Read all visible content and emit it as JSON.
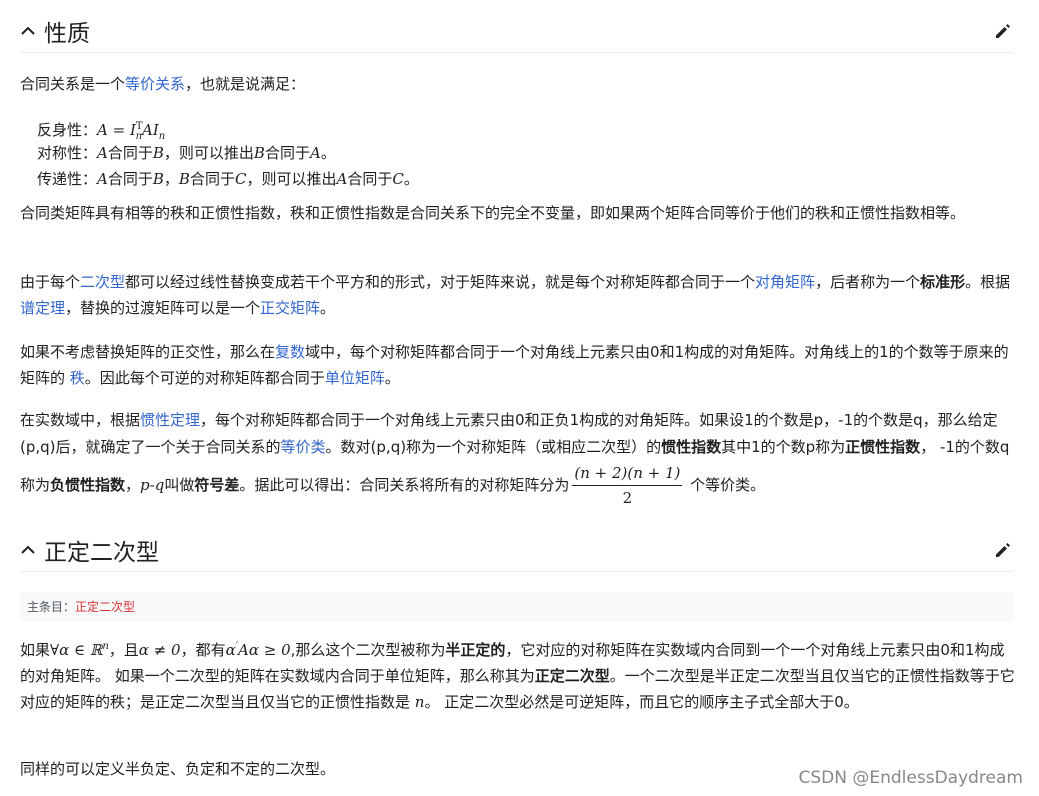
{
  "sections": {
    "properties": {
      "title": "性质"
    },
    "positive_definite": {
      "title": "正定二次型"
    }
  },
  "intro": {
    "t1": "合同关系是一个",
    "link": "等价关系",
    "t2": "，也就是说满足："
  },
  "defs": {
    "reflexive": {
      "label": "反身性：",
      "formula_a": "A",
      "eq": " = ",
      "formula_b": "I",
      "sup": "T",
      "sub": "n",
      "formula_c": "AI",
      "sub2": "n"
    },
    "symmetric": {
      "label": "对称性：",
      "a": "A",
      "t1": "合同于",
      "b": "B",
      "t2": "，则可以推出",
      "b2": "B",
      "t3": "合同于",
      "a2": "A",
      "t4": "。"
    },
    "transitive": {
      "label": "传递性：",
      "a": "A",
      "t1": "合同于",
      "b": "B",
      "t2": "，",
      "b2": "B",
      "t3": "合同于",
      "c": "C",
      "t4": "，则可以推出",
      "a2": "A",
      "t5": "合同于",
      "c2": "C",
      "t6": "。"
    }
  },
  "p1": {
    "text": "合同类矩阵具有相等的秩和正惯性指数，秩和正惯性指数是合同关系下的完全不变量，即如果两个矩阵合同等价于他们的秩和正惯性指数相等。"
  },
  "p2": {
    "t1": "由于每个",
    "l1": "二次型",
    "t2": "都可以经过线性替换变成若干个平方和的形式，对于矩阵来说，就是每个对称矩阵都合同于一个",
    "l2": "对角矩阵",
    "t3": "，后者称为一个",
    "b1": "标准形",
    "t4": "。根据",
    "l3": "谱定理",
    "t5": "，替换的过渡矩阵可以是一个",
    "l4": "正交矩阵",
    "t6": "。"
  },
  "p3": {
    "t1": "如果不考虑替换矩阵的正交性，那么在",
    "l1": "复数",
    "t2": "域中，每个对称矩阵都合同于一个对角线上元素只由0和1构成的对角矩阵。对角线上的1的个数等于原来的矩阵的 ",
    "l2": "秩",
    "t3": "。因此每个可逆的对称矩阵都合同于",
    "l3": "单位矩阵",
    "t4": "。"
  },
  "p4": {
    "t1": "在实数域中，根据",
    "l1": "惯性定理",
    "t2": "，每个对称矩阵都合同于一个对角线上元素只由0和正负1构成的对角矩阵。如果设1的个数是p，-1的个数是q，那么给定(p,q)后，就确定了一个关于合同关系的",
    "l2": "等价类",
    "t3": "。数对(p,q)称为一个对称矩阵（或相应二次型）的",
    "b1": "惯性指数",
    "t4": "其中1的个数p称为",
    "b2": "正惯性指数",
    "t5": "， -1的个数q称为",
    "b3": "负惯性指数",
    "t6": "，",
    "m1": "p-q",
    "t7": "叫做",
    "b4": "符号差",
    "t8": "。据此可以得出：合同关系将所有的对称矩阵分为",
    "frac_num": "(n + 2)(n + 1)",
    "frac_den": "2",
    "t9": " 个等价类。"
  },
  "hatnote": {
    "label": "主条目：",
    "link": "正定二次型"
  },
  "p5": {
    "t1": "如果",
    "m1": "∀α ∈ ℝ",
    "m1sup": "n",
    "t2": "，且",
    "m2": "α ≠ 0",
    "t3": "，都有",
    "m3": "α",
    "m3sup": "′",
    "m3b": "Aα ≥ 0",
    "t4": ",那么这个二次型被称为",
    "b1": "半正定的",
    "t5": "，它对应的对称矩阵在实数域内合同到一个一个对角线上元素只由0和1构成的对角矩阵。 如果一个二次型的矩阵在实数域内合同于单位矩阵，那么称其为",
    "b2": "正定二次型",
    "t6": "。一个二次型是半正定二次型当且仅当它的正惯性指数等于它对应的矩阵的秩；是正定二次型当且仅当它的正惯性指数是 ",
    "m4": "n",
    "t7": "。 正定二次型必然是可逆矩阵，而且它的顺序主子式全部大于0。"
  },
  "p6": {
    "text": "同样的可以定义半负定、负定和不定的二次型。"
  },
  "watermark": {
    "text": "CSDN @EndlessDaydream"
  }
}
